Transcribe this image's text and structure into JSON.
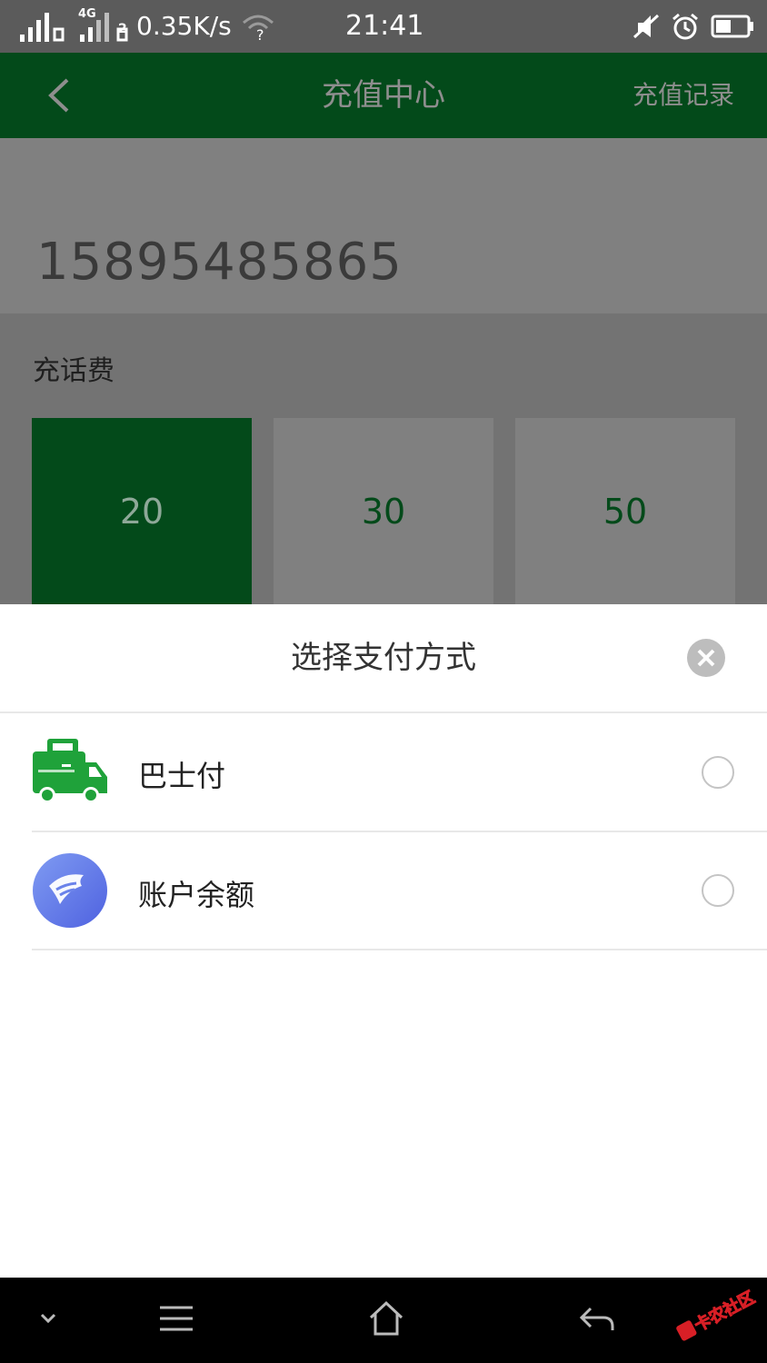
{
  "status_bar": {
    "speed": "0.35K/s",
    "network": "4G",
    "sim2": "2",
    "time": "21:41",
    "icons": [
      "signal-icon",
      "wifi-icon",
      "mute-icon",
      "alarm-icon",
      "battery-icon"
    ]
  },
  "app_bar": {
    "title": "充值中心",
    "record": "充值记录",
    "back_icon": "chevron-left-icon"
  },
  "account": {
    "phone": "15895485865"
  },
  "charge": {
    "label": "充话费",
    "amounts": [
      {
        "value": "20",
        "selected": true
      },
      {
        "value": "30",
        "selected": false
      },
      {
        "value": "50",
        "selected": false
      }
    ]
  },
  "payment_sheet": {
    "title": "选择支付方式",
    "close_icon": "close-icon",
    "methods": [
      {
        "label": "巴士付",
        "icon": "bus-icon",
        "selected": false
      },
      {
        "label": "账户余额",
        "icon": "wallet-icon",
        "selected": false
      }
    ]
  },
  "nav_bar": {
    "icons": [
      "collapse-down-icon",
      "menu-icon",
      "home-icon",
      "back-arrow-icon"
    ],
    "watermark": "卡农社区"
  },
  "colors": {
    "brand_green": "#034a1a",
    "icon_green": "#1fa23a",
    "wallet_blue": "#5f7be8"
  }
}
